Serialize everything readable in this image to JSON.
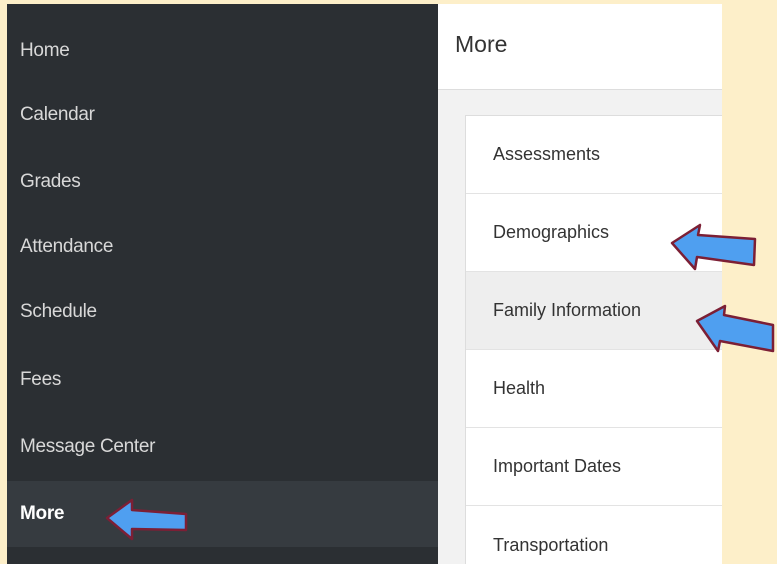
{
  "sidebar": {
    "items": [
      {
        "label": "Home"
      },
      {
        "label": "Calendar"
      },
      {
        "label": "Grades"
      },
      {
        "label": "Attendance"
      },
      {
        "label": "Schedule"
      },
      {
        "label": "Fees"
      },
      {
        "label": "Message Center"
      },
      {
        "label": "More",
        "active": true
      }
    ]
  },
  "main": {
    "title": "More",
    "items": [
      {
        "label": "Assessments"
      },
      {
        "label": "Demographics"
      },
      {
        "label": "Family Information",
        "highlighted": true
      },
      {
        "label": "Health"
      },
      {
        "label": "Important Dates"
      },
      {
        "label": "Transportation"
      }
    ]
  },
  "annotations": {
    "arrow_fill": "#4f9ff0",
    "arrow_outline": "#7c1f35",
    "arrows": [
      "points-to-more",
      "points-to-demographics",
      "points-to-family-information"
    ]
  }
}
